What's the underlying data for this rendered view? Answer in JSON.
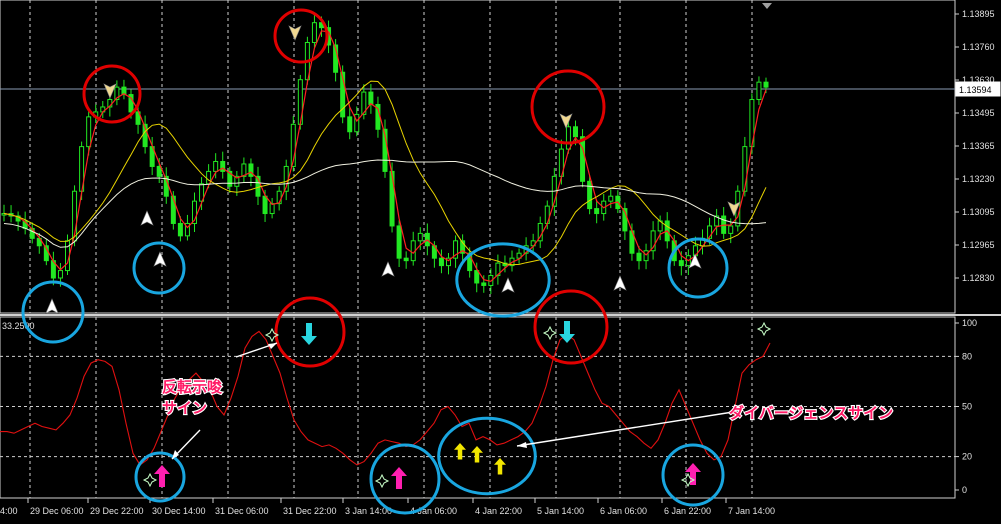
{
  "chart_data": [
    {
      "type": "candlestick",
      "panel": "price",
      "y_ticks": [
        "1.13895",
        "1.13760",
        "1.13630",
        "1.13495",
        "1.13365",
        "1.13230",
        "1.13095",
        "1.12965",
        "1.12830"
      ],
      "ylim": [
        1.1277,
        1.1392
      ],
      "current_price": "1.13594",
      "x_ticks": [
        "4:00",
        "29 Dec 06:00",
        "29 Dec 22:00",
        "30 Dec 14:00",
        "31 Dec 06:00",
        "31 Dec 22:00",
        "3 Jan 14:00",
        "4 Jan 06:00",
        "4 Jan 22:00",
        "5 Jan 14:00",
        "6 Jan 06:00",
        "6 Jan 22:00",
        "7 Jan 14:00"
      ],
      "close_series": [
        1.1309,
        1.1308,
        1.1306,
        1.1303,
        1.1299,
        1.1296,
        1.129,
        1.1283,
        1.1286,
        1.1298,
        1.1318,
        1.1336,
        1.1348,
        1.135,
        1.1352,
        1.1355,
        1.136,
        1.1357,
        1.135,
        1.1345,
        1.1336,
        1.1328,
        1.1324,
        1.1316,
        1.1305,
        1.13,
        1.1305,
        1.1314,
        1.1321,
        1.1326,
        1.133,
        1.1326,
        1.132,
        1.1324,
        1.1329,
        1.1324,
        1.1316,
        1.1309,
        1.1313,
        1.1318,
        1.1328,
        1.1345,
        1.1363,
        1.1378,
        1.1386,
        1.1384,
        1.1377,
        1.1366,
        1.1348,
        1.1342,
        1.1349,
        1.1358,
        1.1353,
        1.1343,
        1.1326,
        1.1304,
        1.1291,
        1.129,
        1.1298,
        1.1301,
        1.1296,
        1.1291,
        1.1288,
        1.1291,
        1.1298,
        1.1293,
        1.1286,
        1.1281,
        1.128,
        1.1284,
        1.1289,
        1.1288,
        1.1291,
        1.1293,
        1.1296,
        1.1298,
        1.1305,
        1.1312,
        1.1324,
        1.1335,
        1.1344,
        1.134,
        1.1322,
        1.1311,
        1.1309,
        1.1314,
        1.1316,
        1.1311,
        1.1302,
        1.1293,
        1.129,
        1.1294,
        1.1302,
        1.1306,
        1.1298,
        1.129,
        1.1288,
        1.1292,
        1.1296,
        1.1299,
        1.1304,
        1.1308,
        1.1301,
        1.1304,
        1.1318,
        1.1336,
        1.1355,
        1.1362,
        1.136
      ],
      "ma_fast_color": "#ff2020",
      "ma_mid_color": "#e8d400",
      "ma_slow_color": "#f0f0e0",
      "candle_color": "#22e822",
      "highlights": [
        {
          "ring": "red",
          "kind": "sell-signal"
        },
        {
          "ring": "red",
          "kind": "sell-signal"
        },
        {
          "ring": "red",
          "kind": "sell-signal"
        },
        {
          "ring": "blue",
          "kind": "buy-signal"
        },
        {
          "ring": "blue",
          "kind": "buy-signal"
        },
        {
          "ring": "blue",
          "kind": "buy-signal"
        },
        {
          "ring": "blue",
          "kind": "buy-signal"
        }
      ]
    },
    {
      "type": "line",
      "panel": "oscillator",
      "indicator_value": "33.2500",
      "y_ticks": [
        "100",
        "80",
        "50",
        "20",
        "0"
      ],
      "ylim": [
        0,
        100
      ],
      "levels": [
        80,
        50,
        20
      ],
      "values": [
        35,
        35,
        34,
        36,
        38,
        40,
        38,
        37,
        36,
        40,
        45,
        55,
        68,
        76,
        78,
        77,
        74,
        60,
        40,
        22,
        15,
        18,
        25,
        35,
        45,
        55,
        62,
        66,
        70,
        65,
        60,
        50,
        45,
        55,
        68,
        85,
        92,
        95,
        90,
        80,
        70,
        55,
        42,
        35,
        30,
        28,
        26,
        27,
        25,
        22,
        18,
        15,
        17,
        22,
        28,
        30,
        29,
        28,
        26,
        27,
        30,
        35,
        40,
        48,
        50,
        45,
        38,
        40,
        30,
        32,
        30,
        27,
        28,
        30,
        32,
        35,
        40,
        50,
        62,
        78,
        90,
        93,
        90,
        80,
        70,
        60,
        52,
        50,
        45,
        40,
        35,
        32,
        28,
        25,
        30,
        40,
        52,
        60,
        50,
        40,
        30,
        22,
        18,
        20,
        30,
        50,
        70,
        75,
        78,
        80,
        88
      ],
      "line_color": "#e01010"
    }
  ],
  "annotations": {
    "reversal_sign": [
      "反転示唆",
      "サイン"
    ],
    "divergence_sign": "ダイバージェンスサイン"
  },
  "colors": {
    "background": "#000000",
    "grid": "#cfcfcf",
    "red_circle": "#e00000",
    "blue_circle": "#19a6e0",
    "down_arrow": "#29d6e0",
    "up_arrow": "#ff1fb0",
    "div_arrow": "#f2e600"
  }
}
